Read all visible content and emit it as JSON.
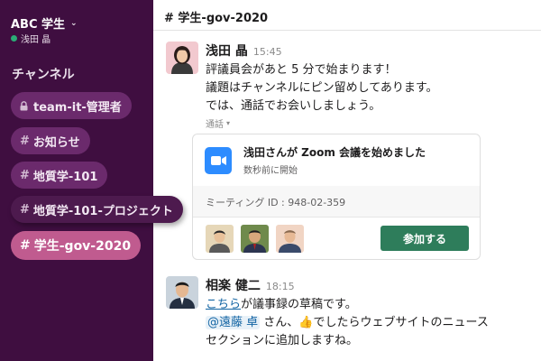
{
  "workspace": {
    "name": "ABC 学生",
    "user": "浅田 晶"
  },
  "sidebar": {
    "section_title": "チャンネル",
    "channels": [
      {
        "label": "team-it-管理者",
        "private": true
      },
      {
        "label": "お知らせ",
        "hash": "#"
      },
      {
        "label": "地質学-101",
        "hash": "#"
      },
      {
        "label": "地質学-101-プロジェクト",
        "hash": "#"
      },
      {
        "label": "学生-gov-2020",
        "hash": "#",
        "active": true
      }
    ]
  },
  "channel_header": {
    "title": "# 学生-gov-2020"
  },
  "messages": [
    {
      "author": "浅田 晶",
      "time": "15:45",
      "lines": [
        "評議員会があと 5 分で始まります！",
        "議題はチャンネルにピン留めしてあります。",
        "では、通話でお会いしましょう。"
      ],
      "call_label": "通話",
      "call": {
        "title": "浅田さんが Zoom 会議を始めました",
        "subtitle": "数秒前に開始",
        "meeting_id": "ミーティング ID : 948-02-359",
        "join_label": "参加する",
        "accent_color": "#2e7d5b",
        "zoom_color": "#2d8cff"
      }
    },
    {
      "author": "相楽 健二",
      "time": "18:15",
      "link_text": "こちら",
      "line1_rest": "が議事録の草稿です。",
      "mention": "@遠藤 卓",
      "line2_mid": " さん、",
      "emoji": "👍",
      "line2_rest": "でしたらウェブサイトのニュース",
      "line3": "セクションに追加しますね。"
    }
  ],
  "colors": {
    "sidebar_bg": "#3f0e40",
    "channel_pill": "#6b2a6c",
    "active_channel": "#c05b8f",
    "link": "#1264a3"
  }
}
